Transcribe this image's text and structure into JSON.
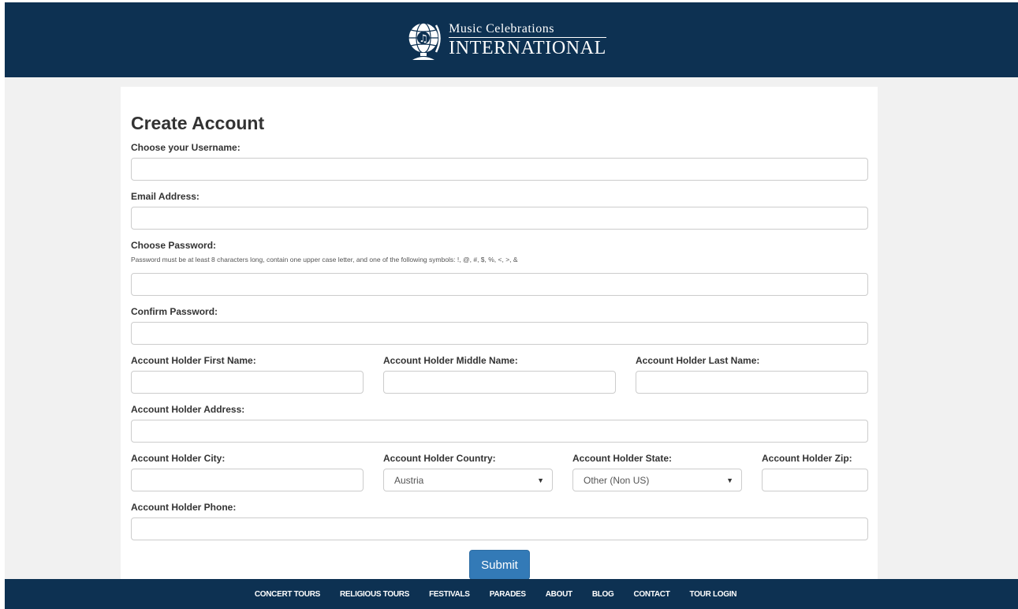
{
  "header": {
    "logo_line1": "Music Celebrations",
    "logo_line2": "INTERNATIONAL"
  },
  "form": {
    "title": "Create Account",
    "username_label": "Choose your Username:",
    "email_label": "Email Address:",
    "password_label": "Choose Password:",
    "password_hint": "Password must be at least 8 characters long, contain one upper case letter, and one of the following symbols: !, @, #, $, %, <, >, &",
    "confirm_label": "Confirm Password:",
    "first_name_label": "Account Holder First Name:",
    "middle_name_label": "Account Holder Middle Name:",
    "last_name_label": "Account Holder Last Name:",
    "address_label": "Account Holder Address:",
    "city_label": "Account Holder City:",
    "country_label": "Account Holder Country:",
    "country_value": "Austria",
    "state_label": "Account Holder State:",
    "state_value": "Other (Non US)",
    "zip_label": "Account Holder Zip:",
    "phone_label": "Account Holder Phone:",
    "submit_label": "Submit"
  },
  "footer": {
    "nav": [
      "CONCERT TOURS",
      "RELIGIOUS TOURS",
      "FESTIVALS",
      "PARADES",
      "ABOUT",
      "BLOG",
      "CONTACT",
      "TOUR LOGIN"
    ]
  },
  "colors": {
    "navy": "#0d3152",
    "button": "#337ab7"
  }
}
